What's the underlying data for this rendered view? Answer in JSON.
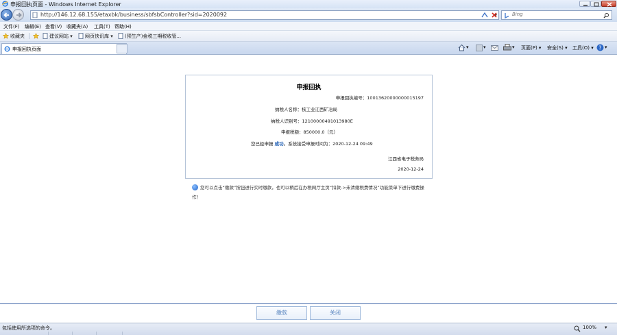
{
  "window": {
    "title": "申报回执页面 - Windows Internet Explorer"
  },
  "address": {
    "url": "http://146.12.68.155/etaxbk/business/sbfsbController?sid=2020092",
    "search_placeholder": "Bing"
  },
  "menu": [
    "文件(F)",
    "编辑(E)",
    "查看(V)",
    "收藏夹(A)",
    "工具(T)",
    "帮助(H)"
  ],
  "favorites": {
    "label": "收藏夹",
    "items": [
      "建议网站 ▾",
      "网页快讯库 ▾",
      "(预生产)金税三期税收管..."
    ]
  },
  "tab": {
    "label": "申报回执页面"
  },
  "commandbar": {
    "page": "页面(P) ▾",
    "safety": "安全(S) ▾",
    "tools": "工具(O) ▾",
    "help": "▾"
  },
  "receipt": {
    "title": "申报回执",
    "receipt_no_label": "申报回执编号：",
    "receipt_no": "10013620000000015197",
    "taxpayer_name_label": "纳税人名称：",
    "taxpayer_name": "核工业江西矿冶局",
    "taxpayer_id_label": "纳税人识别号：",
    "taxpayer_id": "12100000491013980E",
    "amount_label": "申报税额：",
    "amount": "850000.0（元）",
    "declared_prefix": "您已经申报",
    "declared_status": "成功",
    "declared_suffix": "。系统接受申报时间为：2020-12-24 09:49",
    "issuer": "江西省电子税务局",
    "date": "2020-12-24"
  },
  "notice": "您可以点击“缴款”按钮进行实时缴款，也可以稍后在办税网厅主页“扣款->未清缴税费情况”功能菜单下进行缴费操作！",
  "buttons": {
    "pay": "缴款",
    "close": "关闭"
  },
  "status": {
    "text": "包括使用所选项的命令。",
    "zoom": "100%"
  }
}
